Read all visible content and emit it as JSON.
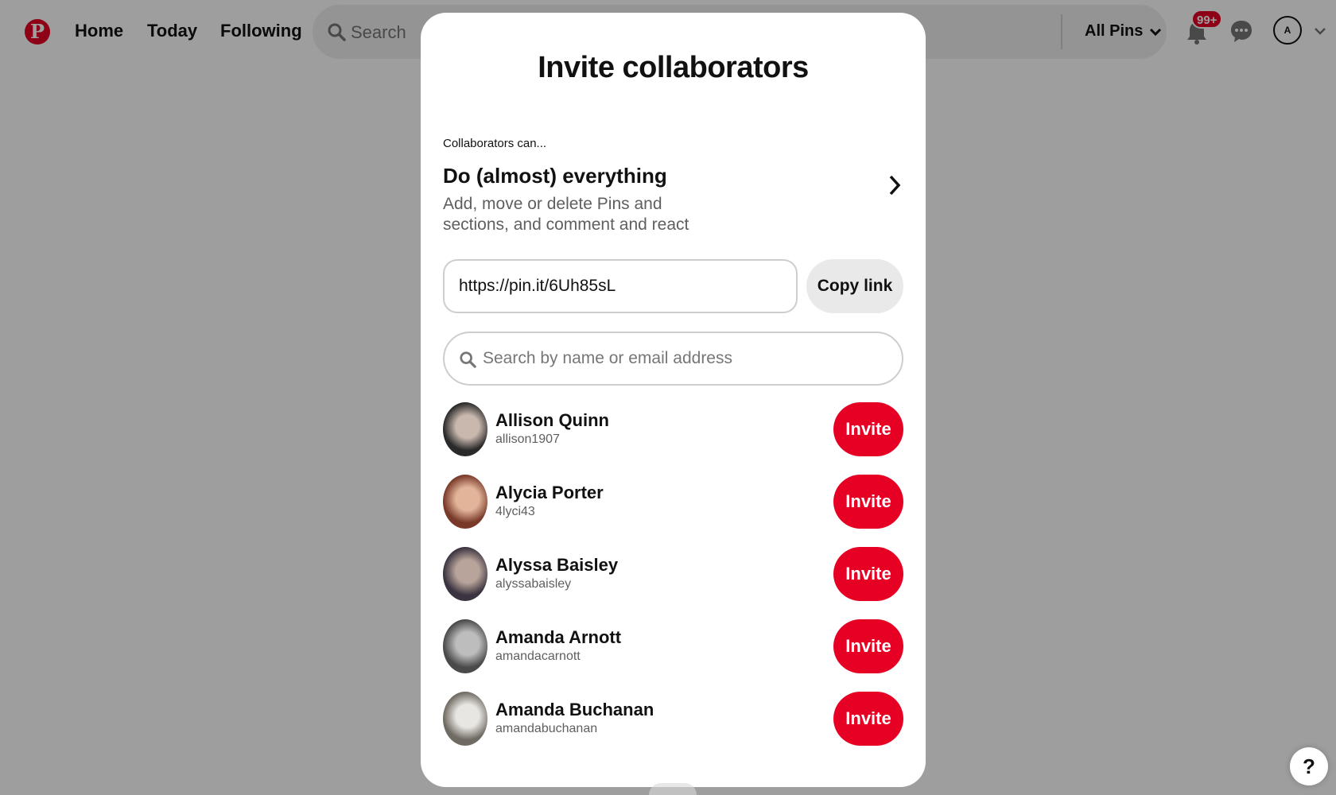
{
  "header": {
    "logo": "P",
    "nav": [
      "Home",
      "Today",
      "Following"
    ],
    "search_placeholder": "Search",
    "filter_label": "All Pins",
    "notifications_badge": "99+",
    "account_initial": "A"
  },
  "modal": {
    "title": "Invite collaborators",
    "permission_label": "Collaborators can...",
    "permission_title": "Do (almost) everything",
    "permission_desc": "Add, move or delete Pins and sections, and comment and react",
    "link_value": "https://pin.it/6Uh85sL",
    "copy_label": "Copy link",
    "search_placeholder": "Search by name or email address",
    "invite_label": "Invite",
    "people": [
      {
        "name": "Allison Quinn",
        "username": "allison1907",
        "avatar_colors": [
          "#2a2a2a",
          "#c9b8ae"
        ]
      },
      {
        "name": "Alycia Porter",
        "username": "4lyci43",
        "avatar_colors": [
          "#7a3a2a",
          "#e2b59a"
        ]
      },
      {
        "name": "Alyssa Baisley",
        "username": "alyssabaisley",
        "avatar_colors": [
          "#3b3440",
          "#b8a49a"
        ]
      },
      {
        "name": "Amanda Arnott",
        "username": "amandacarnott",
        "avatar_colors": [
          "#4a4a4a",
          "#bdbdbd"
        ]
      },
      {
        "name": "Amanda Buchanan",
        "username": "amandabuchanan",
        "avatar_colors": [
          "#6f6a62",
          "#e8e6e2"
        ]
      }
    ]
  },
  "help_label": "?",
  "colors": {
    "brand": "#e60023",
    "overlay": "rgba(0,0,0,0.38)",
    "button_gray": "#e9e9e9"
  }
}
